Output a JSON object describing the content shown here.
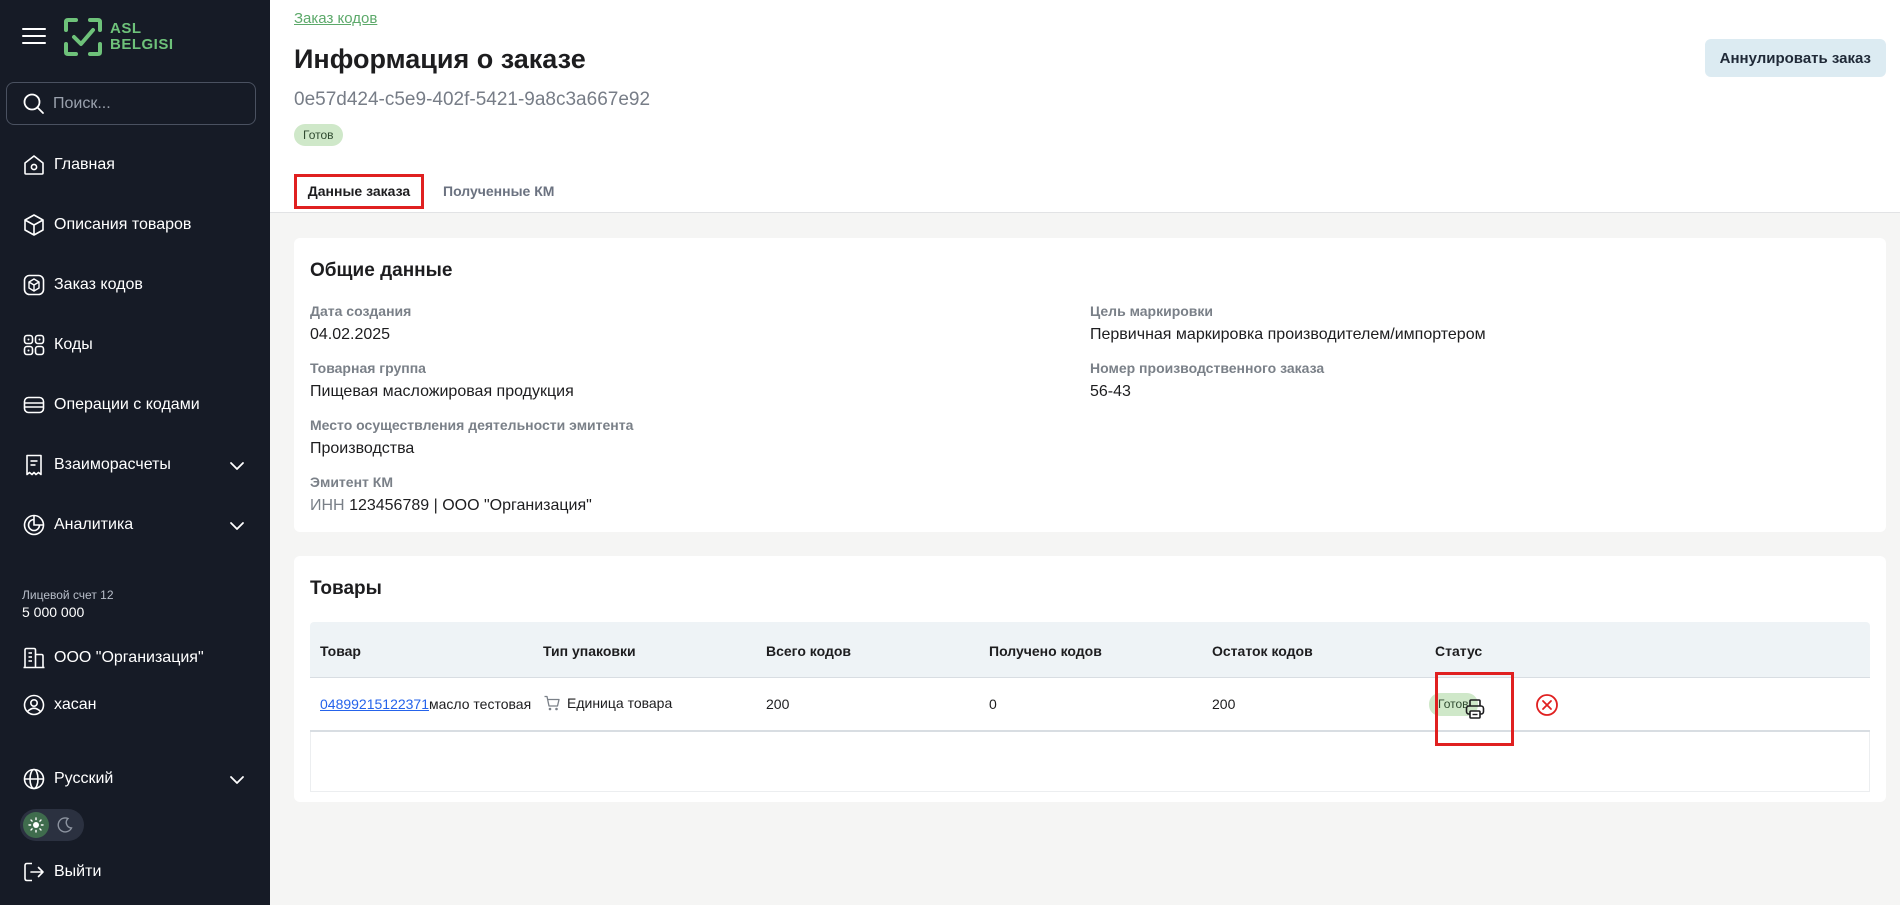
{
  "sidebar": {
    "logo_text": [
      "ASL",
      "BELGISI"
    ],
    "search_placeholder": "Поиск...",
    "nav": [
      {
        "label": "Главная",
        "icon": "home-icon"
      },
      {
        "label": "Описания товаров",
        "icon": "box-icon"
      },
      {
        "label": "Заказ кодов",
        "icon": "order-codes-icon"
      },
      {
        "label": "Коды",
        "icon": "qr-codes-icon"
      },
      {
        "label": "Операции с кодами",
        "icon": "operations-icon"
      },
      {
        "label": "Взаиморасчеты",
        "icon": "receipt-icon",
        "has_chevron": true
      },
      {
        "label": "Аналитика",
        "icon": "analytics-icon",
        "has_chevron": true
      }
    ],
    "account_label": "Лицевой счет 12",
    "account_value": "5 000 000",
    "org": "ООО \"Организация\"",
    "user": "хасан",
    "language": "Русский",
    "logout": "Выйти"
  },
  "header": {
    "breadcrumb": "Заказ кодов",
    "title": "Информация о заказе",
    "order_id": "0e57d424-c5e9-402f-5421-9a8c3a667e92",
    "status": "Готов",
    "cancel_button": "Аннулировать заказ",
    "tabs": [
      "Данные заказа",
      "Полученные КМ"
    ]
  },
  "general": {
    "title": "Общие данные",
    "created_label": "Дата создания",
    "created_value": "04.02.2025",
    "group_label": "Товарная группа",
    "group_value": "Пищевая масложировая продукция",
    "place_label": "Место осуществления деятельности эмитента",
    "place_value": "Производства",
    "emitent_label": "Эмитент КМ",
    "emitent_inn_label": "ИНН",
    "emitent_value": "123456789 | ООО \"Организация\"",
    "purpose_label": "Цель маркировки",
    "purpose_value": "Первичная маркировка производителем/импортером",
    "prod_order_label": "Номер производственного заказа",
    "prod_order_value": "56-43"
  },
  "goods": {
    "title": "Товары",
    "columns": [
      "Товар",
      "Тип упаковки",
      "Всего кодов",
      "Получено кодов",
      "Остаток кодов",
      "Статус"
    ],
    "rows": [
      {
        "gtin": "04899215122371",
        "name": "масло тестовая",
        "package": "Единица товара",
        "total": "200",
        "received": "0",
        "remaining": "200",
        "status": "Готов"
      }
    ]
  },
  "colors": {
    "sidebar_bg": "#161b26",
    "brand_green": "#6ec27a",
    "status_bg": "#cfe8c9",
    "highlight_red": "#e02020"
  }
}
